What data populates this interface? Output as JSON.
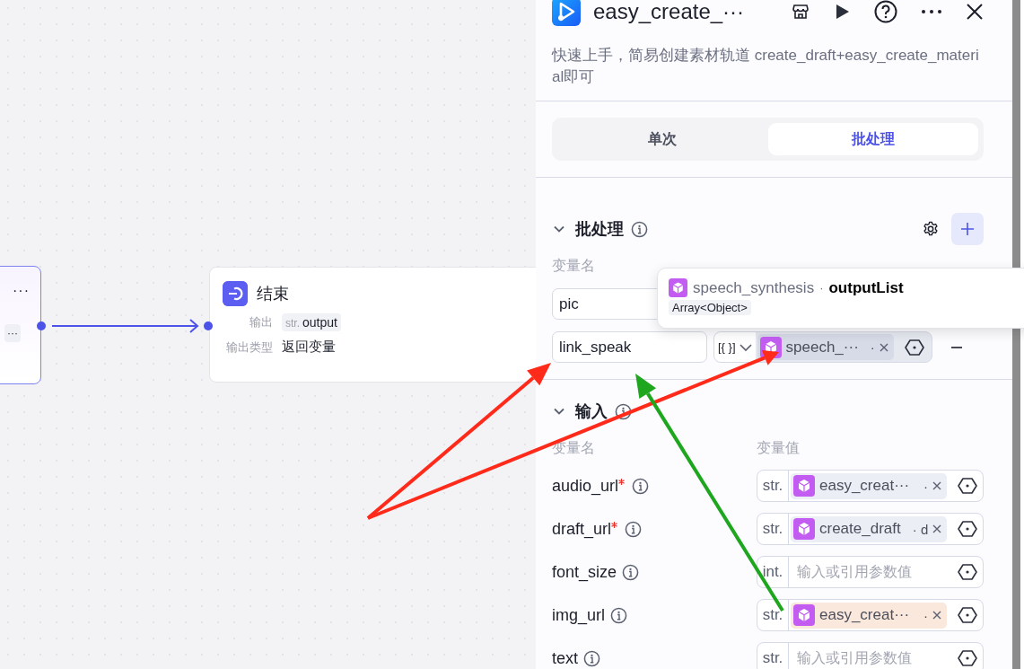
{
  "canvas": {
    "left_node": {
      "menu": "···",
      "chip": "···"
    },
    "end_node": {
      "title": "结束",
      "output_label": "输出",
      "output_type": "str.",
      "output_value": "output",
      "return_label": "输出类型",
      "return_value": "返回变量"
    }
  },
  "panel": {
    "title": "easy_create_···",
    "description": "快速上手，简易创建素材轨道 create_draft+easy_create_material即可",
    "tabs": [
      {
        "label": "单次",
        "selected": false
      },
      {
        "label": "批处理",
        "selected": true
      }
    ],
    "batch": {
      "title": "批处理",
      "expanded": true,
      "name_column": "变量名",
      "rows": [
        {
          "name": "pic"
        },
        {
          "name": "link_speak",
          "type": "[{ }]",
          "ref": "speech_···",
          "ref_tail": "·"
        }
      ]
    },
    "tooltip": {
      "source": "speech_synthesis",
      "separator": "·",
      "field": "outputList",
      "type": "Array<Object>"
    },
    "inputs": {
      "title": "输入",
      "expanded": true,
      "columns": [
        "变量名",
        "变量值"
      ],
      "rows": [
        {
          "name": "audio_url",
          "required": true,
          "type": "str.",
          "kind": "reference",
          "ref": "easy_creat···",
          "ref_tail": "·",
          "highlighted": false
        },
        {
          "name": "draft_url",
          "required": true,
          "type": "str.",
          "kind": "reference",
          "ref": "create_draft",
          "ref_tail": "· d",
          "highlighted": false
        },
        {
          "name": "font_size",
          "required": false,
          "type": "int.",
          "kind": "placeholder",
          "placeholder": "输入或引用参数值"
        },
        {
          "name": "img_url",
          "required": false,
          "type": "str.",
          "kind": "reference",
          "ref": "easy_creat···",
          "ref_tail": "·",
          "highlighted": true
        },
        {
          "name": "text",
          "required": false,
          "type": "str.",
          "kind": "placeholder",
          "placeholder": "输入或引用参数值"
        }
      ]
    }
  },
  "annotations": [
    {
      "kind": "arrow",
      "color": "#ff2a1a"
    },
    {
      "kind": "arrow",
      "color": "#ff2a1a"
    },
    {
      "kind": "arrow",
      "color": "#1fa61f"
    }
  ]
}
